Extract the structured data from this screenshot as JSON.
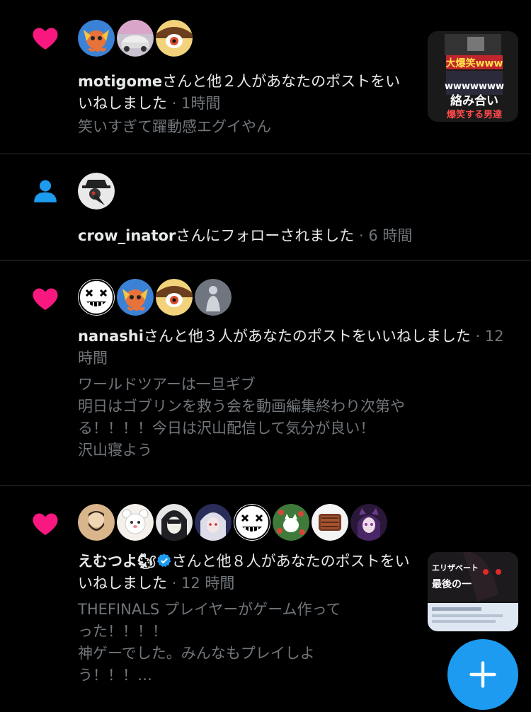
{
  "notifications": [
    {
      "type": "like",
      "icon": "heart-icon",
      "name": "motigome",
      "action": "さんと他２人があなたのポストをいいねしました",
      "time": "· 1時間",
      "preview": "笑いすぎて躍動感エグイやん",
      "avatars": [
        "octopus-avatar",
        "car-avatar",
        "eye-creature-avatar"
      ],
      "thumbnail": {
        "caption_top": "大爆笑www",
        "caption_mid": "wwwwwww",
        "caption_bottom": "絡み合い",
        "caption_last": "爆笑する男達"
      }
    },
    {
      "type": "follow",
      "icon": "person-icon",
      "name": "crow_inator",
      "action": "さんにフォローされました",
      "time": "· 6 時間",
      "avatars": [
        "plague-doctor-avatar"
      ]
    },
    {
      "type": "like",
      "icon": "heart-icon",
      "name": "nanashi",
      "action": "さんと他３人があなたのポストをいいねしました",
      "time": "· 12 時間",
      "preview": "ワールドツアーは一旦ギブ\n明日はゴブリンを救う会を動画編集終わり次第や\nる！！！！今日は沢山配信して気分が良い！\n沢山寝よう",
      "avatars": [
        "x-eyes-avatar",
        "octopus-avatar",
        "eye-creature-avatar",
        "figure-avatar"
      ]
    },
    {
      "type": "like",
      "icon": "heart-icon",
      "name": "えむつよ🐿",
      "action": "さんと他８人があなたのポストをいいねしました",
      "time": "· 12 時間",
      "preview": "THEFINALS プレイヤーがゲーム作って\nった！！！！\n神ゲーでした。みんなもプレイしよ\nう！！！…",
      "avatars": [
        "bearded-avatar",
        "white-bear-avatar",
        "dark-hair-avatar",
        "white-hair-avatar",
        "x-eyes-avatar",
        "cat-pattern-avatar",
        "toast-avatar",
        "purple-cat-avatar"
      ],
      "thumbnail": {
        "caption_top": "エリザベート",
        "caption_mid": "最後の一",
        "caption_bottom": "",
        "caption_last": ""
      }
    }
  ],
  "fab": {
    "icon": "plus-icon"
  },
  "colors": {
    "heart": "#f91880",
    "person": "#1d9bf0",
    "fab": "#1d9bf0",
    "meta": "#71767b",
    "divider": "#2f3336"
  }
}
